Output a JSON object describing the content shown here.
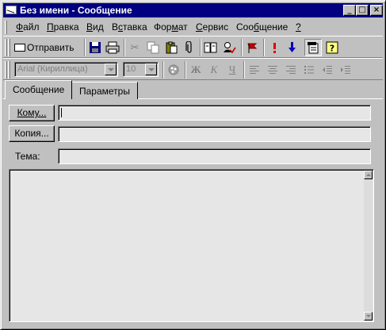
{
  "window": {
    "title": "Без имени - Сообщение"
  },
  "title_buttons": {
    "minimize": "_",
    "maximize": "□",
    "close": "×"
  },
  "menu": [
    {
      "text": "Файл",
      "ul": "Ф"
    },
    {
      "text": "Правка",
      "ul": "П"
    },
    {
      "text": "Вид",
      "ul": "В"
    },
    {
      "text": "Вставка",
      "ul": "с"
    },
    {
      "text": "Формат",
      "ul": "м"
    },
    {
      "text": "Сервис",
      "ul": "С"
    },
    {
      "text": "Сообщение",
      "ul": "б"
    },
    {
      "text": "?",
      "ul": "?"
    }
  ],
  "toolbar": {
    "send_label": "Отправить",
    "icons": [
      "save-icon",
      "print-icon",
      "cut-icon",
      "copy-icon",
      "paste-icon",
      "attach-icon",
      "address-book-icon",
      "check-names-icon",
      "flag-icon",
      "high-priority-icon",
      "low-priority-icon",
      "properties-icon",
      "help-icon"
    ]
  },
  "format": {
    "font": "Arial (Кириллица)",
    "size": "10",
    "bold": "Ж",
    "italic": "К",
    "underline": "Ч"
  },
  "tabs": [
    {
      "label": "Сообщение",
      "active": true
    },
    {
      "label": "Параметры",
      "active": false
    }
  ],
  "headers": {
    "to_label": "Кому...",
    "cc_label": "Копия...",
    "subject_label": "Тема:",
    "to_value": "",
    "cc_value": "",
    "subject_value": ""
  },
  "body": {
    "text": ""
  }
}
